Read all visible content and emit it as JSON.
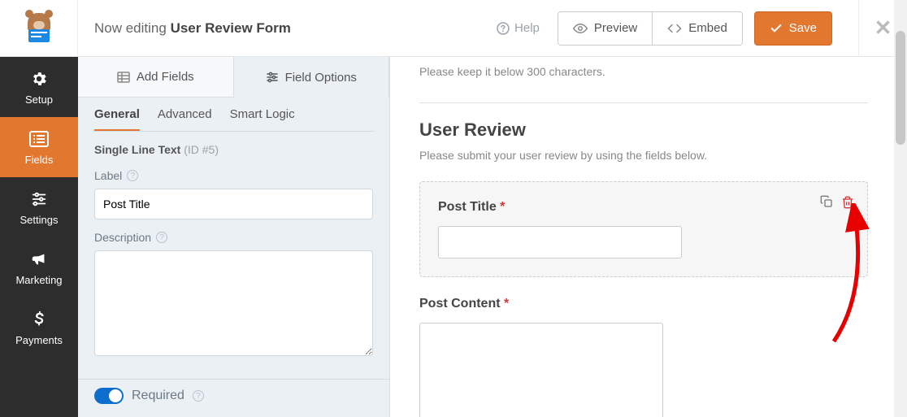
{
  "topbar": {
    "editing_prefix": "Now editing ",
    "form_name": "User Review Form",
    "help": "Help",
    "preview": "Preview",
    "embed": "Embed",
    "save": "Save"
  },
  "sidenav": {
    "items": [
      {
        "label": "Setup"
      },
      {
        "label": "Fields"
      },
      {
        "label": "Settings"
      },
      {
        "label": "Marketing"
      },
      {
        "label": "Payments"
      }
    ]
  },
  "panel": {
    "tabs": {
      "add_fields": "Add Fields",
      "field_options": "Field Options"
    },
    "subtabs": {
      "general": "General",
      "advanced": "Advanced",
      "smart_logic": "Smart Logic"
    },
    "field_type": "Single Line Text ",
    "field_id": "(ID #5)",
    "label_label": "Label",
    "label_value": "Post Title",
    "desc_label": "Description",
    "desc_value": "",
    "required_label": "Required"
  },
  "preview": {
    "hint": "Please keep it below 300 characters.",
    "section_title": "User Review",
    "section_desc": "Please submit your user review by using the fields below.",
    "fields": [
      {
        "label": "Post Title",
        "required": true
      },
      {
        "label": "Post Content",
        "required": true
      }
    ]
  }
}
